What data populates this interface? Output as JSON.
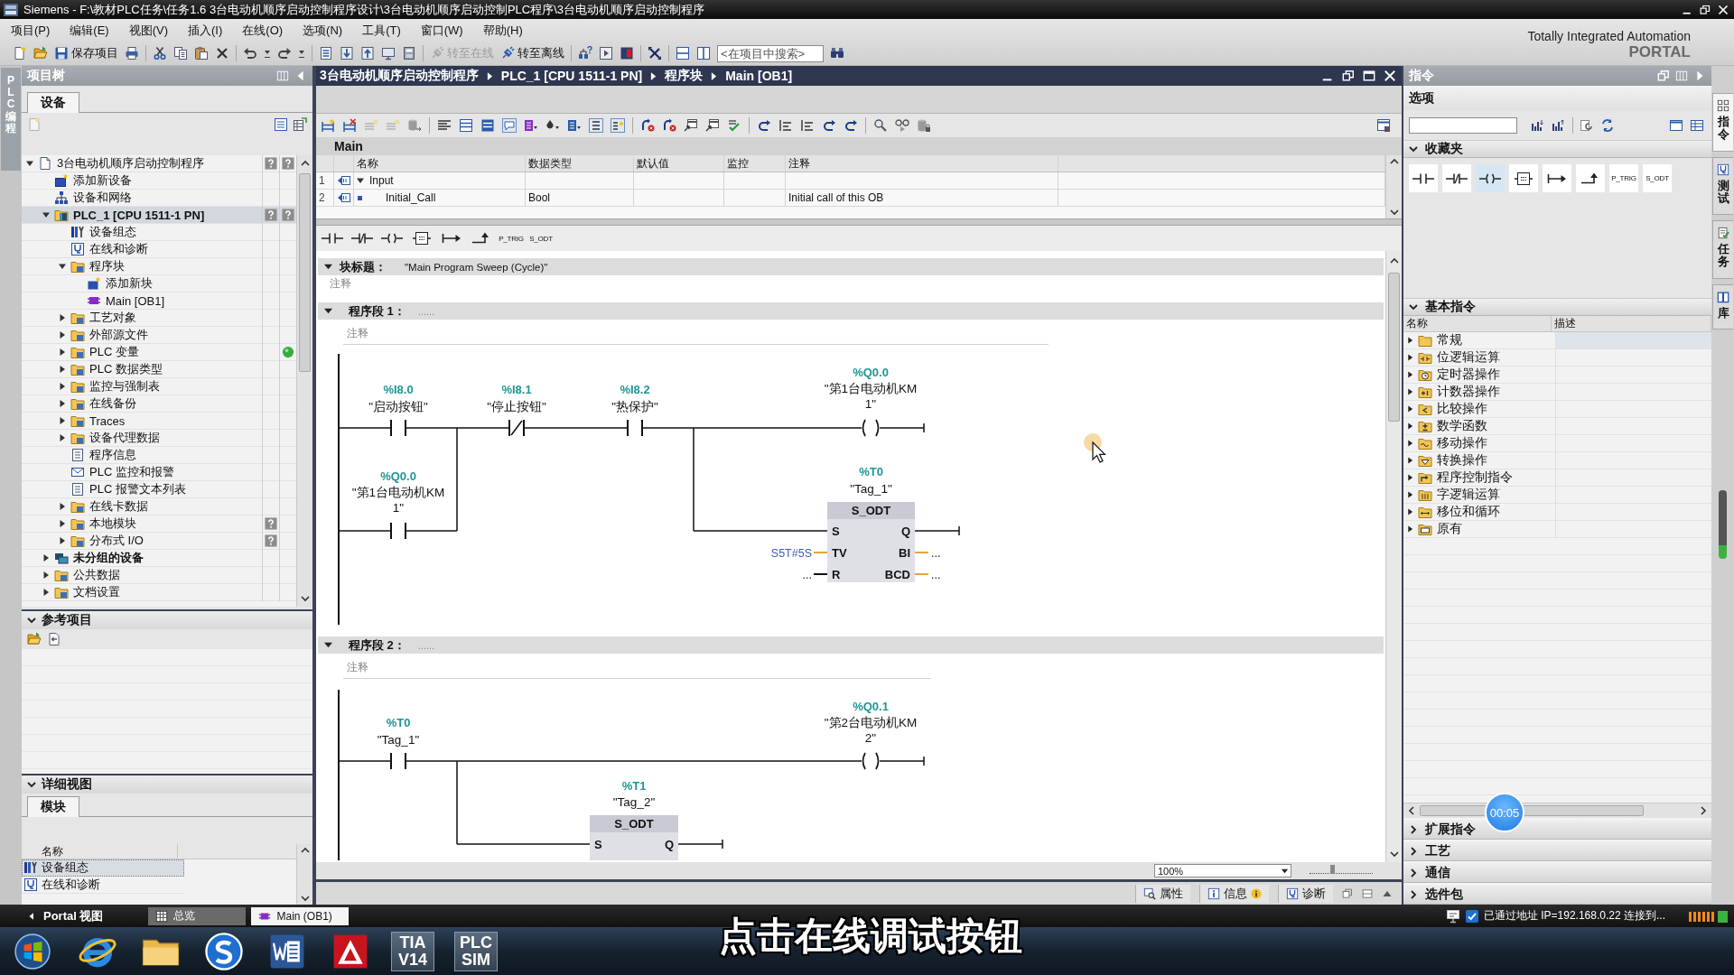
{
  "window": {
    "title": "Siemens - F:\\教材PLC任务\\任务1.6 3台电动机顺序启动控制程序设计\\3台电动机顺序启动控制PLC程序\\3台电动机顺序启动控制程序"
  },
  "menu": [
    "项目(P)",
    "编辑(E)",
    "视图(V)",
    "插入(I)",
    "在线(O)",
    "选项(N)",
    "工具(T)",
    "窗口(W)",
    "帮助(H)"
  ],
  "toolbar": {
    "save": "保存项目",
    "go_online": {
      "label": "转至在线",
      "disabled": true
    },
    "go_offline": {
      "label": "转至离线",
      "disabled": false
    },
    "search": {
      "placeholder": "<在项目中搜索>"
    }
  },
  "branding": {
    "line_1": "Totally Integrated Automation",
    "line_2": "PORTAL"
  },
  "left_tab": {
    "label": "PLC 编程"
  },
  "project_tree": {
    "title": "项目树",
    "tabs": [
      {
        "label": "设备",
        "selected": true
      }
    ],
    "items": [
      {
        "label": "3台电动机顺序启动控制程序",
        "kind": "project",
        "expanded": true,
        "selected": false,
        "compare_status": {
          "kind": "unknown"
        },
        "online_status": {
          "kind": "unknown"
        },
        "children": [
          {
            "label": "添加新设备",
            "kind": "add-device",
            "selected": false
          },
          {
            "label": "设备和网络",
            "kind": "network",
            "selected": false
          },
          {
            "label": "PLC_1 [CPU 1511-1 PN]",
            "kind": "plc",
            "expanded": true,
            "selected": true,
            "bold": true,
            "compare_status": {
              "kind": "unknown"
            },
            "online_status": {
              "kind": "unknown"
            },
            "children": [
              {
                "label": "设备组态",
                "kind": "config",
                "selected": false
              },
              {
                "label": "在线和诊断",
                "kind": "diagnostics",
                "selected": false
              },
              {
                "label": "程序块",
                "kind": "folder",
                "expanded": true,
                "selected": false,
                "children": [
                  {
                    "label": "添加新块",
                    "kind": "add-block",
                    "selected": false
                  },
                  {
                    "label": "Main [OB1]",
                    "kind": "block",
                    "selected": false
                  }
                ]
              },
              {
                "label": "工艺对象",
                "kind": "folder",
                "expanded": false,
                "selected": false
              },
              {
                "label": "外部源文件",
                "kind": "folder",
                "expanded": false,
                "selected": false
              },
              {
                "label": "PLC 变量",
                "kind": "folder",
                "expanded": false,
                "selected": false,
                "online_status": {
                  "kind": "ok"
                }
              },
              {
                "label": "PLC 数据类型",
                "kind": "folder",
                "expanded": false,
                "selected": false
              },
              {
                "label": "监控与强制表",
                "kind": "folder",
                "expanded": false,
                "selected": false
              },
              {
                "label": "在线备份",
                "kind": "folder",
                "expanded": false,
                "selected": false
              },
              {
                "label": "Traces",
                "kind": "folder",
                "expanded": false,
                "selected": false
              },
              {
                "label": "设备代理数据",
                "kind": "folder",
                "expanded": false,
                "selected": false
              },
              {
                "label": "程序信息",
                "kind": "document",
                "selected": false
              },
              {
                "label": "PLC 监控和报警",
                "kind": "alarm",
                "selected": false
              },
              {
                "label": "PLC 报警文本列表",
                "kind": "document",
                "selected": false
              },
              {
                "label": "在线卡数据",
                "kind": "folder",
                "expanded": false,
                "selected": false
              },
              {
                "label": "本地模块",
                "kind": "folder",
                "expanded": false,
                "selected": false,
                "compare_status": {
                  "kind": "unknown"
                }
              },
              {
                "label": "分布式 I/O",
                "kind": "folder",
                "expanded": false,
                "selected": false,
                "compare_status": {
                  "kind": "unknown"
                }
              }
            ]
          },
          {
            "label": "未分组的设备",
            "kind": "device-group",
            "expanded": false,
            "selected": false,
            "bold": true
          },
          {
            "label": "公共数据",
            "kind": "folder",
            "expanded": false,
            "selected": false
          },
          {
            "label": "文档设置",
            "kind": "folder",
            "expanded": false,
            "selected": false
          }
        ]
      }
    ]
  },
  "reference_projects": {
    "title": "参考项目",
    "expanded": true
  },
  "details_view": {
    "title": "详细视图",
    "expanded": true,
    "tabs": [
      {
        "label": "模块",
        "selected": true
      }
    ],
    "column": "名称",
    "rows": [
      {
        "label": "设备组态",
        "kind": "config",
        "selected": true
      },
      {
        "label": "在线和诊断",
        "kind": "diagnostics",
        "selected": false
      }
    ]
  },
  "editor": {
    "breadcrumb": [
      "3台电动机顺序启动控制程序",
      "PLC_1 [CPU 1511-1 PN]",
      "程序块",
      "Main [OB1]"
    ],
    "block_name": "Main",
    "interface": {
      "columns": [
        "名称",
        "数据类型",
        "默认值",
        "监控",
        "注释"
      ],
      "rows": [
        {
          "number": "1",
          "kind": "section",
          "name": "Input",
          "expanded": true
        },
        {
          "number": "2",
          "kind": "parameter",
          "name": "Initial_Call",
          "data_type": "Bool",
          "comment": "Initial call of this OB"
        }
      ]
    },
    "favorites": [
      {
        "kind": "contact-no"
      },
      {
        "kind": "contact-nc"
      },
      {
        "kind": "coil"
      },
      {
        "kind": "empty-box"
      },
      {
        "kind": "branch-open"
      },
      {
        "kind": "branch-close"
      },
      {
        "kind": "text",
        "label": "P_TRIG"
      },
      {
        "kind": "text",
        "label": "S_ODT"
      }
    ],
    "block_title": {
      "label": "块标题：",
      "value": "\"Main Program Sweep (Cycle)\"",
      "comment": "注释",
      "expanded": true
    },
    "networks": [
      {
        "label": "程序段 1：",
        "title": "......",
        "comment": "注释",
        "expanded": true,
        "elements": [
          {
            "kind": "contact-no",
            "address": "%I8.0",
            "tag": "\"启动按钮\""
          },
          {
            "kind": "contact-nc",
            "address": "%I8.1",
            "tag": "\"停止按钮\""
          },
          {
            "kind": "contact-no",
            "address": "%I8.2",
            "tag": "\"热保护\""
          },
          {
            "kind": "coil",
            "address": "%Q0.0",
            "tag": "\"第1台电动机KM\n1\""
          },
          {
            "kind": "contact-no",
            "address": "%Q0.0",
            "tag": "\"第1台电动机KM\n1\""
          },
          {
            "kind": "timer",
            "address": "%T0",
            "tag": "\"Tag_1\"",
            "type": "S_ODT",
            "inputs": [
              {
                "pin": "S"
              },
              {
                "pin": "TV",
                "value": "S5T#5S",
                "kind": "word",
                "constant": true
              },
              {
                "pin": "R",
                "value": "...",
                "kind": "bool"
              }
            ],
            "outputs": [
              {
                "pin": "Q"
              },
              {
                "pin": "BI",
                "value": "...",
                "kind": "word"
              },
              {
                "pin": "BCD",
                "value": "...",
                "kind": "word"
              }
            ]
          }
        ]
      },
      {
        "label": "程序段 2：",
        "title": "......",
        "comment": "注释",
        "expanded": true,
        "elements": [
          {
            "kind": "contact-no",
            "address": "%T0",
            "tag": "\"Tag_1\""
          },
          {
            "kind": "coil",
            "address": "%Q0.1",
            "tag": "\"第2台电动机KM\n2\""
          },
          {
            "kind": "timer",
            "address": "%T1",
            "tag": "\"Tag_2\"",
            "type": "S_ODT",
            "inputs": [
              {
                "pin": "S"
              }
            ],
            "outputs": [
              {
                "pin": "Q"
              }
            ]
          }
        ]
      }
    ],
    "zoom": {
      "value": "100%",
      "level": 0.35
    }
  },
  "inspector_tabs": [
    {
      "label": "属性",
      "selected": false,
      "alert": false
    },
    {
      "label": "信息",
      "selected": false,
      "alert": true
    },
    {
      "label": "诊断",
      "selected": false,
      "alert": false
    }
  ],
  "instructions": {
    "title": "指令",
    "options": "选项",
    "favorites": {
      "title": "收藏夹",
      "expanded": true,
      "items": [
        {
          "kind": "contact-no",
          "selected": false
        },
        {
          "kind": "contact-nc",
          "selected": false
        },
        {
          "kind": "coil",
          "selected": true
        },
        {
          "kind": "empty-box",
          "selected": false
        },
        {
          "kind": "branch-open",
          "selected": false
        },
        {
          "kind": "branch-close",
          "selected": false
        },
        {
          "kind": "text",
          "label": "P_TRIG",
          "selected": false
        },
        {
          "kind": "text",
          "label": "S_ODT",
          "selected": false
        }
      ]
    },
    "basic": {
      "title": "基本指令",
      "expanded": true,
      "columns": [
        "名称",
        "描述"
      ],
      "items": [
        {
          "label": "常规",
          "kind": "folder",
          "selected": true
        },
        {
          "label": "位逻辑运算",
          "kind": "bit-logic",
          "selected": false
        },
        {
          "label": "定时器操作",
          "kind": "timer",
          "selected": false
        },
        {
          "label": "计数器操作",
          "kind": "counter",
          "selected": false
        },
        {
          "label": "比较操作",
          "kind": "compare",
          "selected": false
        },
        {
          "label": "数学函数",
          "kind": "math",
          "selected": false
        },
        {
          "label": "移动操作",
          "kind": "move",
          "selected": false
        },
        {
          "label": "转换操作",
          "kind": "convert",
          "selected": false
        },
        {
          "label": "程序控制指令",
          "kind": "program-control",
          "selected": false
        },
        {
          "label": "字逻辑运算",
          "kind": "word-logic",
          "selected": false
        },
        {
          "label": "移位和循环",
          "kind": "shift",
          "selected": false
        },
        {
          "label": "原有",
          "kind": "legacy",
          "selected": false
        }
      ]
    },
    "sections": [
      {
        "title": "扩展指令",
        "expanded": false
      },
      {
        "title": "工艺",
        "expanded": false
      },
      {
        "title": "通信",
        "expanded": false
      },
      {
        "title": "选件包",
        "expanded": false
      }
    ]
  },
  "side_tabs": [
    {
      "label": "指令",
      "selected": true
    },
    {
      "label": "测试",
      "selected": false
    },
    {
      "label": "任务",
      "selected": false
    },
    {
      "label": "库",
      "selected": false
    }
  ],
  "portal_bar": {
    "portal_view": "Portal 视图",
    "tabs": [
      {
        "label": "总览",
        "kind": "overview",
        "selected": false
      },
      {
        "label": "Main (OB1)",
        "kind": "block",
        "selected": true
      }
    ],
    "status": "已通过地址 IP=192.168.0.22 连接到..."
  },
  "taskbar": [
    {
      "kind": "orb"
    },
    {
      "kind": "ring"
    },
    {
      "kind": "folder"
    },
    {
      "kind": "swirl"
    },
    {
      "kind": "document"
    },
    {
      "kind": "triangle"
    },
    {
      "kind": "tile",
      "label": "TIA\nV14"
    },
    {
      "kind": "tile",
      "label": "PLC\nSIM"
    }
  ],
  "subtitle": "点击在线调试按钮",
  "recording_timer": "00:05"
}
